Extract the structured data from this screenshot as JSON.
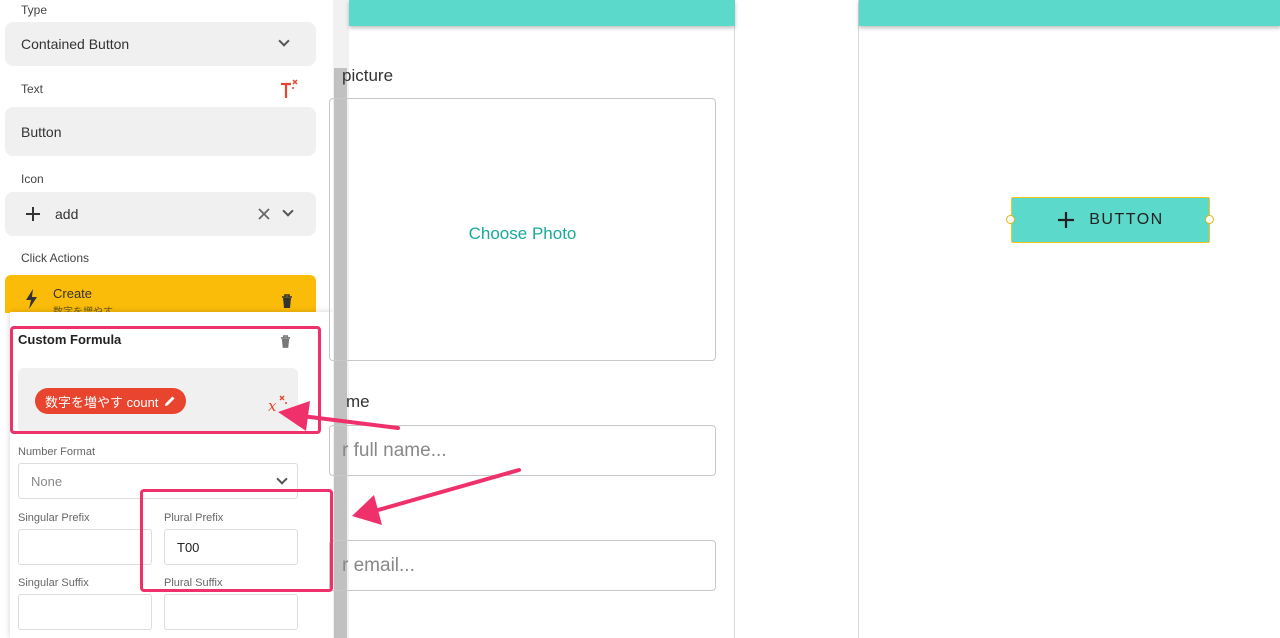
{
  "panel": {
    "type_label": "Type",
    "type_value": "Contained Button",
    "text_label": "Text",
    "text_value": "Button",
    "icon_label": "Icon",
    "icon_value": "add",
    "click_actions_label": "Click Actions",
    "action": {
      "title": "Create",
      "subtitle": "数字を増やす"
    }
  },
  "formula": {
    "title": "Custom Formula",
    "chip_text": "数字を増やす count",
    "number_format_label": "Number Format",
    "number_format_value": "None",
    "singular_prefix_label": "Singular Prefix",
    "singular_prefix_value": "",
    "plural_prefix_label": "Plural Prefix",
    "plural_prefix_value": "T00",
    "singular_suffix_label": "Singular Suffix",
    "singular_suffix_value": "",
    "plural_suffix_label": "Plural Suffix",
    "plural_suffix_value": ""
  },
  "form_screen": {
    "picture_label": "picture",
    "choose_photo": "Choose Photo",
    "name_label": "me",
    "name_placeholder": "r full name...",
    "email_placeholder": "r email..."
  },
  "canvas": {
    "button_label": "BUTTON",
    "button_icon": "plus-icon"
  },
  "colors": {
    "accent": "#5bd9cb",
    "action": "#fbbc09",
    "chip": "#e8442e",
    "annotation": "#f0306a",
    "link": "#1aa99a"
  }
}
